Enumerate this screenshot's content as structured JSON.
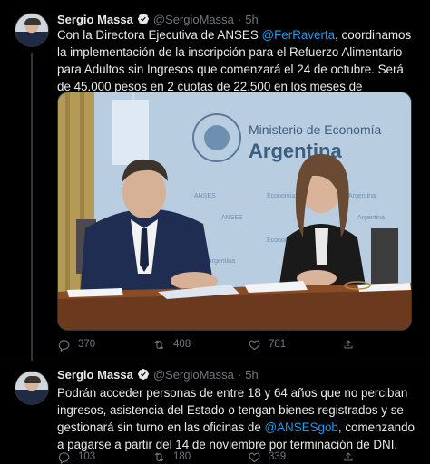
{
  "tweets": [
    {
      "author": "Sergio Massa",
      "handle": "@SergioMassa",
      "separator": "·",
      "time": "5h",
      "text_before": "Con la Directora Ejecutiva de ANSES ",
      "mention": "@FerRaverta",
      "text_after": ", coordinamos la implementación de la inscripción para el Refuerzo Alimentario para Adultos sin Ingresos que comenzará el 24 de octubre. Será de 45.000 pesos en 2 cuotas de 22.500 en los meses de noviembre y diciembre.",
      "media": {
        "banner_title": "Ministerio de Economía",
        "banner_country": "Argentina",
        "backdrop_labels": [
          "ANSES",
          "Economía",
          "Argentina",
          "ANSES",
          "Argentina",
          "Economía",
          "Argentina"
        ]
      },
      "replies": "370",
      "retweets": "408",
      "likes": "781"
    },
    {
      "author": "Sergio Massa",
      "handle": "@SergioMassa",
      "separator": "·",
      "time": "5h",
      "text_before": "Podrán acceder personas de entre 18 y 64 años que no perciban ingresos, asistencia del Estado o tengan bienes registrados y se gestionará sin turno en las oficinas de ",
      "mention": "@ANSESgob",
      "text_after": ", comenzando a pagarse a partir del 14 de noviembre por terminación de DNI.",
      "replies": "103",
      "retweets": "180",
      "likes": "339"
    }
  ],
  "colors": {
    "background": "#000000",
    "text": "#e7e9ea",
    "muted": "#71767b",
    "link": "#1d9bf0",
    "divider": "#2f3336"
  },
  "icons": [
    "avatar",
    "verified-badge-icon",
    "reply-icon",
    "retweet-icon",
    "like-icon",
    "share-icon"
  ]
}
